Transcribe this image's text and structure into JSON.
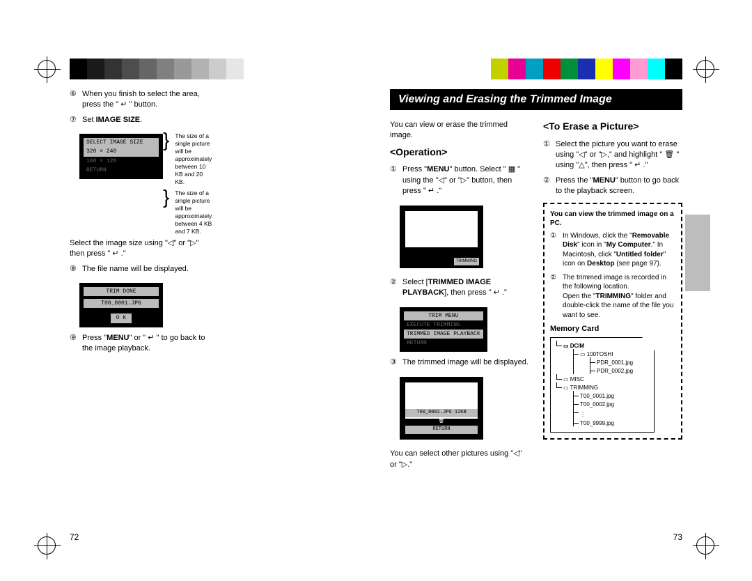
{
  "page_left": {
    "number": "72"
  },
  "page_right": {
    "number": "73"
  },
  "title": "Viewing and Erasing the Trimmed Image",
  "left_col1": {
    "step6": "When you finish to select the area, press the \" ↵ \" button.",
    "step7_pre": "Set ",
    "step7_bold": "IMAGE SIZE",
    "step7_post": ".",
    "lcd1": {
      "line1": "SELECT IMAGE SIZE",
      "line2": "320 × 240",
      "line3": "160 × 120",
      "line4": "RETURN"
    },
    "note1": "The size of a single picture will be approximately between 10 KB and 20 KB.",
    "note2": "The size of a single picture will be approximately between 4 KB and 7 KB.",
    "select_size": "Select the image size using \"◁\" or \"▷\" then press \" ↵ .\"",
    "step8": "The file name will be displayed.",
    "lcd2": {
      "line1": "TRIM DONE",
      "line2": "T00_0001.JPG",
      "line3": "O K"
    },
    "step9_pre": "Press \"",
    "step9_bold": "MENU",
    "step9_post": "\" or \" ↵ \" to go back to the image playback."
  },
  "operation": {
    "heading": "<Operation>",
    "intro": "You can view or erase the trimmed image.",
    "step1_pre": "Press \"",
    "step1_bold": "MENU",
    "step1_mid": "\" button. Select \" ▦ \" using the \"◁\" or \"▷\" button, then press \" ↵ .\"",
    "step2_pre": "Select [",
    "step2_bold": "TRIMMED IMAGE PLAYBACK",
    "step2_post": "], then press \" ↵ .\"",
    "lcd": {
      "line1": "TRIM MENU",
      "line2": "EXECUTE TRIMMING",
      "line3": "TRIMMED IMAGE PLAYBACK",
      "line4": "RETURN"
    },
    "step3": "The trimmed image will be displayed.",
    "img_caption": "T00_0001.JPG  12KB",
    "img_bottom": "RETURN",
    "select_other": "You can select other pictures using \"◁\" or \"▷.\""
  },
  "erase": {
    "heading": "<To Erase a Picture>",
    "step1": "Select the picture you want to erase using \"◁\" or \"▷,\" and highlight \" 🗑 \" using \"△\", then press \" ↵ .\"",
    "step2_pre": "Press the \"",
    "step2_bold": "MENU",
    "step2_post": "\" button to go back to the playback screen."
  },
  "pcbox": {
    "title": "You can view the trimmed image on a PC.",
    "l1a": "In Windows, click the \"",
    "l1b": "Removable Disk",
    "l1c": "\" icon in \"",
    "l1d": "My Computer",
    "l1e": ".\" In Macintosh, click \"",
    "l1f": "Untitled folder",
    "l1g": "\" icon on ",
    "l1h": "Desktop",
    "l1i": " (see page 97).",
    "l2a": "The trimmed image is recorded in the following location.",
    "l2b": "Open the \"",
    "l2c": "TRIMMING",
    "l2d": "\" folder and double-click the name of the file you want to see.",
    "memcard_title": "Memory Card",
    "tree": {
      "dcim": "DCIM",
      "f1": "100TOSHI",
      "p1": "PDR_0001.jpg",
      "p2": "PDR_0002.jpg",
      "misc": "MISC",
      "trimming": "TRIMMING",
      "t1": "T00_0001.jpg",
      "t2": "T00_0002.jpg",
      "t3": "T00_9999.jpg"
    }
  }
}
